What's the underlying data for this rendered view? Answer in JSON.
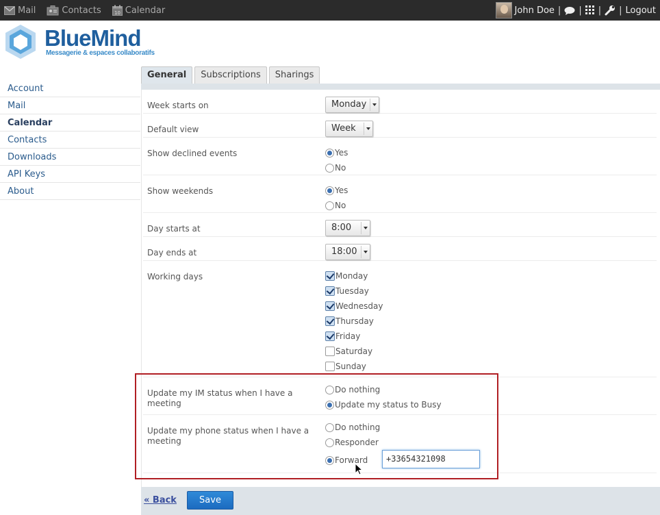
{
  "topbar": {
    "apps": [
      {
        "label": "Mail",
        "icon": "mail-icon"
      },
      {
        "label": "Contacts",
        "icon": "contacts-icon"
      },
      {
        "label": "Calendar",
        "icon": "calendar-icon"
      }
    ],
    "user_name": "John Doe",
    "sep": "|",
    "logout": "Logout"
  },
  "logo": {
    "title": "BlueMind",
    "subtitle": "Messagerie & espaces collaboratifs"
  },
  "sidebar": {
    "items": [
      {
        "label": "Account"
      },
      {
        "label": "Mail"
      },
      {
        "label": "Calendar",
        "active": true
      },
      {
        "label": "Contacts"
      },
      {
        "label": "Downloads"
      },
      {
        "label": "API Keys"
      },
      {
        "label": "About"
      }
    ]
  },
  "tabs": [
    {
      "label": "General",
      "active": true
    },
    {
      "label": "Subscriptions"
    },
    {
      "label": "Sharings"
    }
  ],
  "form": {
    "week_start": {
      "label": "Week starts on",
      "value": "Monday"
    },
    "default_view": {
      "label": "Default view",
      "value": "Week"
    },
    "show_declined": {
      "label": "Show declined events",
      "options": [
        "Yes",
        "No"
      ],
      "selected": "Yes"
    },
    "show_weekends": {
      "label": "Show weekends",
      "options": [
        "Yes",
        "No"
      ],
      "selected": "Yes"
    },
    "day_start": {
      "label": "Day starts at",
      "value": "8:00"
    },
    "day_end": {
      "label": "Day ends at",
      "value": "18:00"
    },
    "working_days": {
      "label": "Working days",
      "days": [
        {
          "label": "Monday",
          "checked": true
        },
        {
          "label": "Tuesday",
          "checked": true
        },
        {
          "label": "Wednesday",
          "checked": true
        },
        {
          "label": "Thursday",
          "checked": true
        },
        {
          "label": "Friday",
          "checked": true
        },
        {
          "label": "Saturday",
          "checked": false
        },
        {
          "label": "Sunday",
          "checked": false
        }
      ]
    },
    "im_status": {
      "label": "Update my IM status when I have a meeting",
      "options": [
        "Do nothing",
        "Update my status to Busy"
      ],
      "selected": "Update my status to Busy"
    },
    "phone_status": {
      "label": "Update my phone status when I have a meeting",
      "options": [
        "Do nothing",
        "Responder",
        "Forward"
      ],
      "selected": "Forward",
      "forward_number": "+33654321098"
    }
  },
  "footer": {
    "back": "« Back",
    "save": "Save"
  },
  "colors": {
    "highlight_border": "#b01e23",
    "save_button": "#1c6bc0",
    "topbar": "#2b2b2b"
  }
}
